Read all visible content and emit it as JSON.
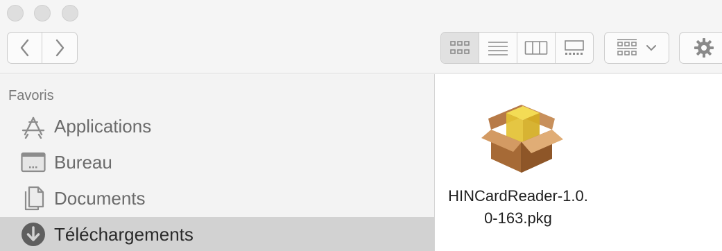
{
  "window": {
    "traffic_lights": [
      "close",
      "minimize",
      "zoom"
    ]
  },
  "toolbar": {
    "back_icon": "chevron-left-icon",
    "forward_icon": "chevron-right-icon",
    "view_modes": [
      "icon-view",
      "list-view",
      "column-view",
      "gallery-view"
    ],
    "active_view": "icon-view",
    "arrange_icon": "group-by-icon",
    "action_icon": "gear-icon"
  },
  "sidebar": {
    "heading": "Favoris",
    "items": [
      {
        "label": "Applications",
        "icon": "applications-icon",
        "selected": false
      },
      {
        "label": "Bureau",
        "icon": "desktop-icon",
        "selected": false
      },
      {
        "label": "Documents",
        "icon": "documents-icon",
        "selected": false
      },
      {
        "label": "Téléchargements",
        "icon": "downloads-icon",
        "selected": true
      }
    ]
  },
  "content": {
    "files": [
      {
        "name": "HINCardReader-1.0.0-163.pkg",
        "icon": "package-icon"
      }
    ]
  }
}
